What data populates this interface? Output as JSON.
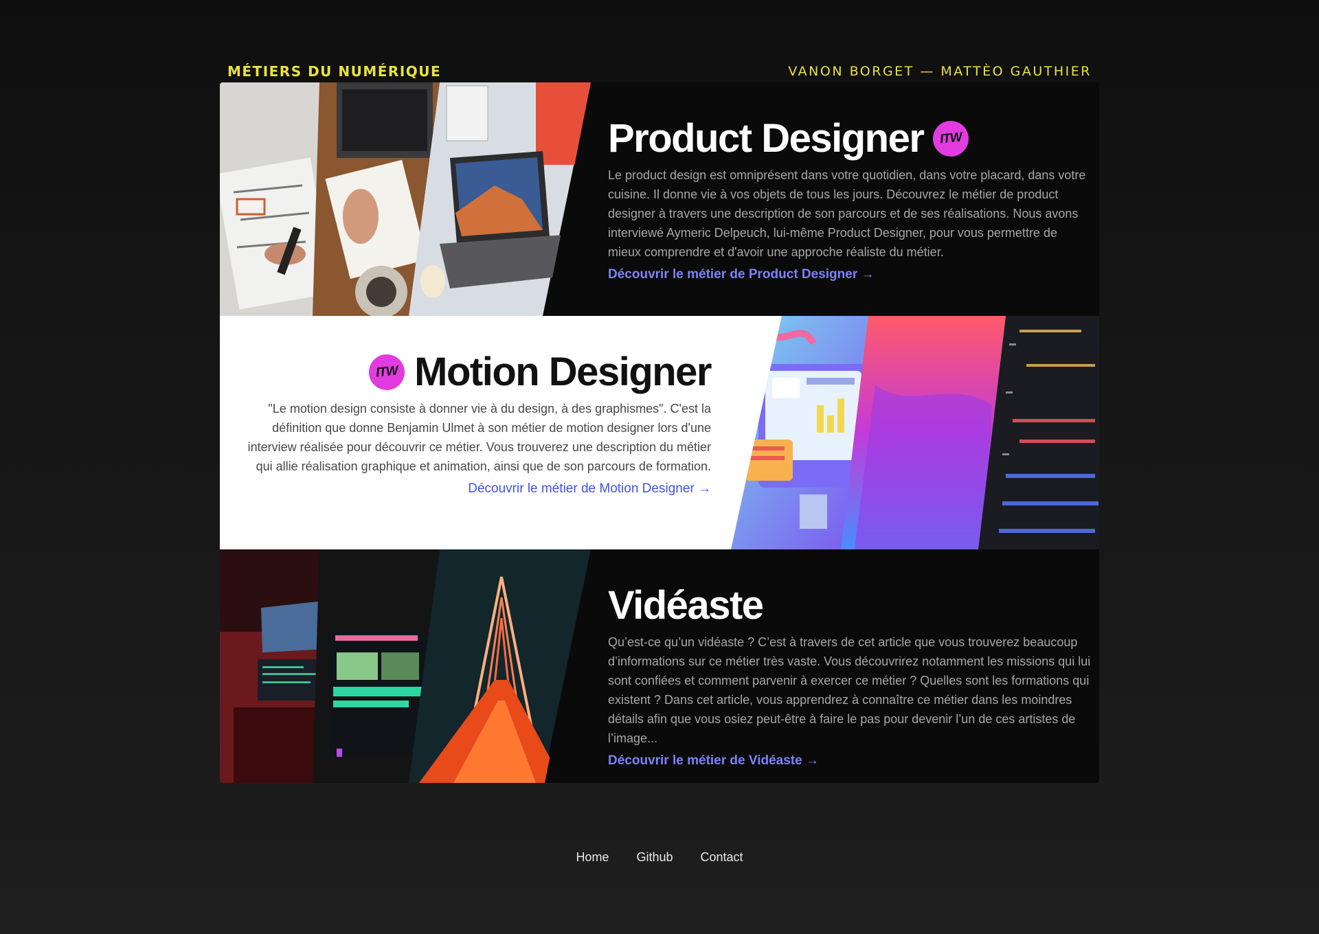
{
  "header": {
    "site_title": "MÉTIERS DU NUMÉRIQUE",
    "authors": "VANON BORGET — MATTÈO GAUTHIER"
  },
  "cards": [
    {
      "title": "Product Designer",
      "badge": "ITW",
      "description": "Le product design est omniprésent dans votre quotidien, dans votre placard, dans votre cuisine. Il donne vie à vos objets de tous les jours. Découvrez le métier de product designer à travers une description de son parcours et de ses réalisations. Nous avons interviewé Aymeric Delpeuch, lui-même Product Designer, pour vous permettre de mieux comprendre et d'avoir une approche réaliste du métier.",
      "link": "Découvrir le métier de Product Designer →"
    },
    {
      "title": "Motion Designer",
      "badge": "ITW",
      "description": "\"Le motion design consiste à donner vie à du design, à des graphismes\". C'est la définition que donne Benjamin Ulmet à son métier de motion designer lors d'une interview réalisée pour découvrir ce métier. Vous trouverez une description du métier qui allie réalisation graphique et animation, ainsi que de son parcours de formation.",
      "link": "Découvrir le métier de Motion Designer →"
    },
    {
      "title": "Vidéaste",
      "description": "Qu’est-ce qu’un vidéaste ? C’est à travers de cet article que vous trouverez beaucoup d’informations sur ce métier très vaste. Vous découvrirez notamment les missions qui lui sont confiées et comment parvenir à exercer ce métier ? Quelles sont les formations qui existent ? Dans cet article, vous apprendrez à connaître ce métier dans les moindres détails afin que vous osiez peut-être à faire le pas pour devenir l’un de ces artistes de l’image...",
      "link": "Découvrir le métier de Vidéaste →"
    }
  ],
  "footer": {
    "links": [
      "Home",
      "Github",
      "Contact"
    ]
  }
}
